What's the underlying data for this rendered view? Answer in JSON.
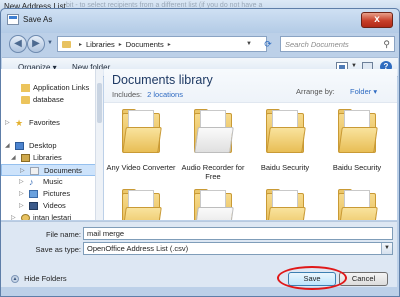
{
  "outer_window": {
    "title": "New Address List",
    "background_text": "bit - to select recipients from a different list (if you do not have a"
  },
  "dialog": {
    "title": "Save As",
    "close_label": "x"
  },
  "address_bar": {
    "breadcrumb": [
      "Libraries",
      "Documents"
    ],
    "search_placeholder": "Search Documents"
  },
  "toolbar": {
    "organize_label": "Organize ▾",
    "new_folder_label": "New folder",
    "help_label": "?"
  },
  "nav_pane": {
    "items": [
      {
        "label": "Application Links",
        "icon": "link-folder-icon"
      },
      {
        "label": "database",
        "icon": "folder-icon"
      },
      {
        "label": "Favorites",
        "icon": "star-icon"
      },
      {
        "label": "Desktop",
        "icon": "desktop-icon"
      },
      {
        "label": "Libraries",
        "icon": "library-icon"
      },
      {
        "label": "Documents",
        "icon": "documents-icon"
      },
      {
        "label": "Music",
        "icon": "music-icon"
      },
      {
        "label": "Pictures",
        "icon": "pictures-icon"
      },
      {
        "label": "Videos",
        "icon": "videos-icon"
      },
      {
        "label": "intan lestari",
        "icon": "user-folder-icon"
      }
    ]
  },
  "content": {
    "library_title": "Documents library",
    "includes_label": "Includes:",
    "includes_link": "2 locations",
    "arrange_by_label": "Arrange by:",
    "arrange_by_value": "Folder ▾",
    "folders": [
      {
        "name": "Any Video Converter"
      },
      {
        "name": "Audio Recorder for Free"
      },
      {
        "name": "Baidu Security"
      },
      {
        "name": "Baidu Security"
      },
      {
        "name": ""
      },
      {
        "name": ""
      },
      {
        "name": ""
      },
      {
        "name": ""
      }
    ]
  },
  "form": {
    "file_name_label": "File name:",
    "file_name_value": "mail merge",
    "save_as_type_label": "Save as type:",
    "save_as_type_value": "OpenOffice Address List (.csv)",
    "hide_folders_label": "Hide Folders",
    "save_label": "Save",
    "cancel_label": "Cancel"
  },
  "colors": {
    "title_bar": "#cfe0f3",
    "close_button": "#c8402a",
    "library_title": "#1f3a64",
    "link": "#2f6bc2",
    "highlight": "#e01818"
  }
}
